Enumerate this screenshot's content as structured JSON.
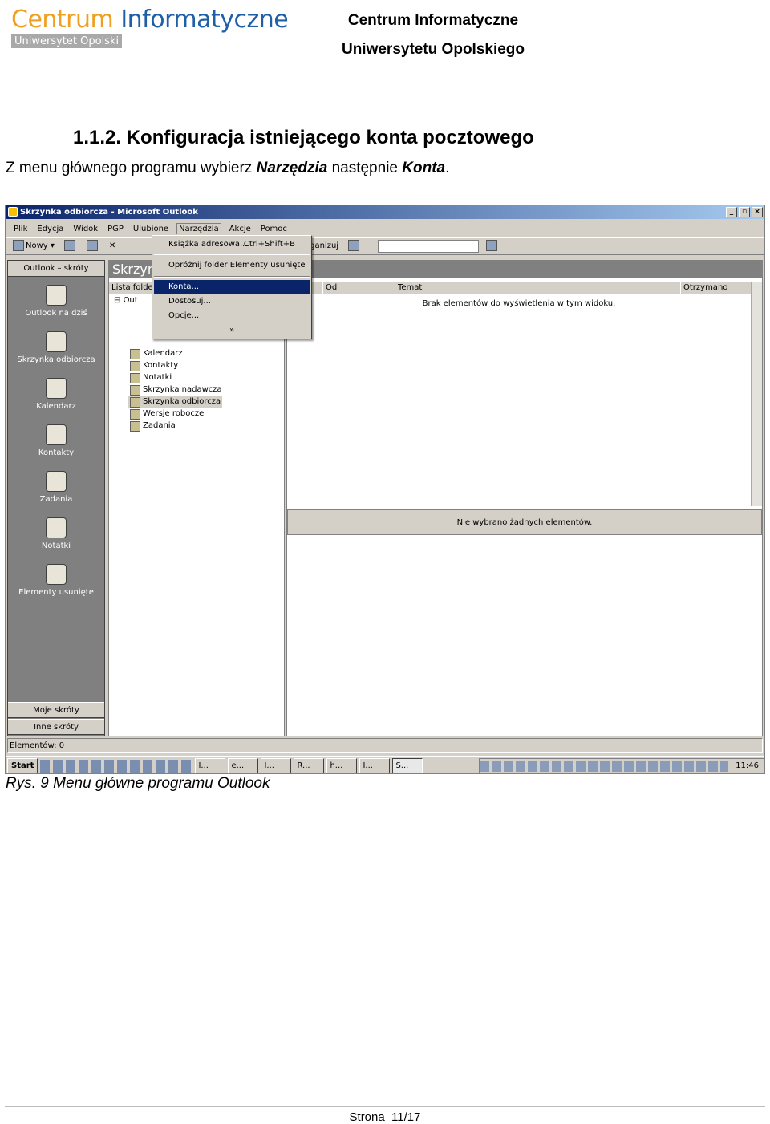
{
  "header": {
    "logo_word1": "Centrum",
    "logo_word2": "Informatyczne",
    "logo_sub": "Uniwersytet Opolski",
    "line1": "Centrum Informatyczne",
    "line2": "Uniwersytetu Opolskiego"
  },
  "section_title": "1.1.2. Konfiguracja istniejącego konta pocztowego",
  "intro": {
    "before": "Z menu głównego programu wybierz ",
    "term1": "Narzędzia",
    "middle": " następnie ",
    "term2": "Konta",
    "after": "."
  },
  "screenshot": {
    "title": "Skrzynka odbiorcza - Microsoft Outlook",
    "menu": [
      "Plik",
      "Edycja",
      "Widok",
      "PGP",
      "Ulubione",
      "Narzędzia",
      "Akcje",
      "Pomoc"
    ],
    "toolbar": {
      "new": "Nowy",
      "organize": "Organizuj"
    },
    "sidebar": {
      "header": "Outlook – skróty",
      "items": [
        "Outlook na dziś",
        "Skrzynka odbiorcza",
        "Kalendarz",
        "Kontakty",
        "Zadania",
        "Notatki",
        "Elementy usunięte"
      ],
      "footer1": "Moje skróty",
      "footer2": "Inne skróty"
    },
    "folder_panel": {
      "title": "Skrzyn",
      "list_header": "Lista folder",
      "root": "Out",
      "tree": [
        "Kalendarz",
        "Kontakty",
        "Notatki",
        "Skrzynka nadawcza",
        "Skrzynka odbiorcza",
        "Wersje robocze",
        "Zadania"
      ]
    },
    "dropdown": {
      "address_book": "Książka adresowa...",
      "address_book_shortcut": "Ctrl+Shift+B",
      "empty_deleted": "Opróżnij folder Elementy usunięte",
      "accounts": "Konta...",
      "customize": "Dostosuj...",
      "options": "Opcje...",
      "more": "»"
    },
    "columns": {
      "from": "Od",
      "subject": "Temat",
      "received": "Otrzymano"
    },
    "empty_view": "Brak elementów do wyświetlenia w tym widoku.",
    "no_selection": "Nie wybrano żadnych elementów.",
    "status": "Elementów: 0",
    "taskbar": {
      "start": "Start",
      "tasks": [
        "I...",
        "e...",
        "I...",
        "R...",
        "h...",
        "I...",
        "S..."
      ],
      "clock": "11:46"
    }
  },
  "caption": "Rys. 9 Menu główne programu Outlook",
  "footer": "Strona  11/17"
}
